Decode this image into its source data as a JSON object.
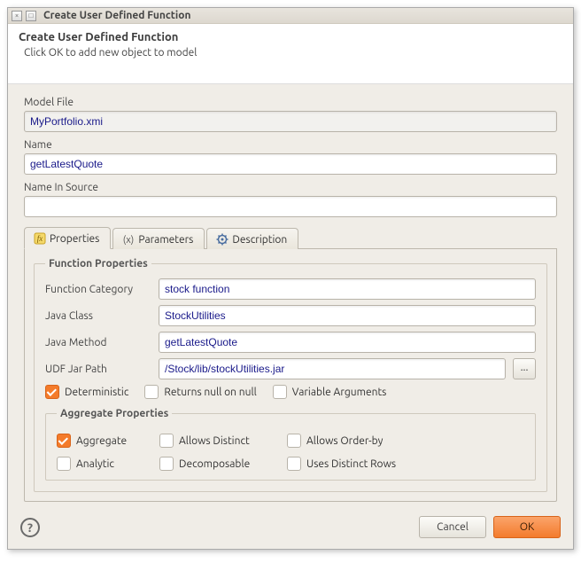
{
  "window": {
    "title": "Create User Defined Function"
  },
  "header": {
    "title": "Create User Defined Function",
    "subtitle": "Click OK to add new object to model"
  },
  "fields": {
    "model_file": {
      "label": "Model File",
      "value": "MyPortfolio.xmi"
    },
    "name": {
      "label": "Name",
      "value": "getLatestQuote"
    },
    "name_in_source": {
      "label": "Name In Source",
      "value": ""
    }
  },
  "tabs": {
    "properties": "Properties",
    "parameters": "Parameters",
    "description": "Description"
  },
  "function_properties": {
    "legend": "Function Properties",
    "category": {
      "label": "Function Category",
      "value": "stock function"
    },
    "java_class": {
      "label": "Java Class",
      "value": "StockUtilities"
    },
    "java_method": {
      "label": "Java Method",
      "value": "getLatestQuote"
    },
    "udf_jar_path": {
      "label": "UDF Jar Path",
      "value": "/Stock/lib/stockUtilities.jar"
    },
    "browse": "...",
    "checks": {
      "deterministic": "Deterministic",
      "returns_null": "Returns null on null",
      "varargs": "Variable Arguments"
    }
  },
  "aggregate_properties": {
    "legend": "Aggregate Properties",
    "checks": {
      "aggregate": "Aggregate",
      "allows_distinct": "Allows Distinct",
      "allows_orderby": "Allows Order-by",
      "analytic": "Analytic",
      "decomposable": "Decomposable",
      "uses_distinct_rows": "Uses Distinct Rows"
    }
  },
  "footer": {
    "help": "?",
    "cancel": "Cancel",
    "ok": "OK"
  }
}
